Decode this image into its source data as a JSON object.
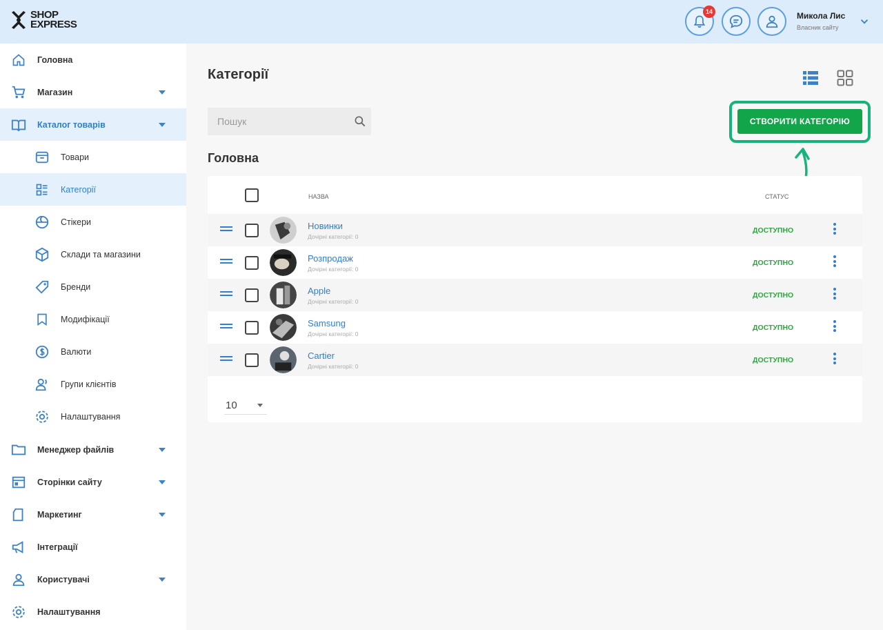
{
  "header": {
    "logo_line1": "SHOP",
    "logo_line2": "EXPRESS",
    "notification_count": "14",
    "user_name": "Микола Лис",
    "user_role": "Власник сайту",
    "accent_color": "#5a9fe0"
  },
  "sidebar": {
    "items": [
      {
        "label": "Головна",
        "icon": "home-icon"
      },
      {
        "label": "Магазин",
        "icon": "cart-icon",
        "has_submenu": true
      },
      {
        "label": "Каталог товарів",
        "icon": "catalog-icon",
        "has_submenu": true,
        "active": true
      },
      {
        "label": "Товари",
        "icon": "box-icon"
      },
      {
        "label": "Категорії",
        "icon": "categories-icon",
        "active": true
      },
      {
        "label": "Стікери",
        "icon": "sticker-icon"
      },
      {
        "label": "Склади та магазини",
        "icon": "warehouse-icon"
      },
      {
        "label": "Бренди",
        "icon": "tag-icon"
      },
      {
        "label": "Модифікації",
        "icon": "bookmark-icon"
      },
      {
        "label": "Валюти",
        "icon": "currency-icon"
      },
      {
        "label": "Групи клієнтів",
        "icon": "user-group-icon"
      },
      {
        "label": "Налаштування",
        "icon": "gear-icon"
      },
      {
        "label": "Менеджер файлів",
        "icon": "folder-icon",
        "has_submenu": true
      },
      {
        "label": "Сторінки сайту",
        "icon": "pages-icon",
        "has_submenu": true
      },
      {
        "label": "Маркетинг",
        "icon": "marketing-icon",
        "has_submenu": true
      },
      {
        "label": "Інтеграції",
        "icon": "megaphone-icon"
      },
      {
        "label": "Користувачі",
        "icon": "user-icon",
        "has_submenu": true
      },
      {
        "label": "Налаштування",
        "icon": "gear-icon"
      }
    ]
  },
  "main": {
    "title": "Категорії",
    "search_placeholder": "Пошук",
    "create_button": "СТВОРИТИ КАТЕГОРІЮ",
    "section_title": "Головна",
    "table": {
      "col_name": "Назва",
      "col_status": "Статус",
      "rows": [
        {
          "name": "Новинки",
          "sub": "Дочірні категорії: 0",
          "status": "ДОСТУПНО"
        },
        {
          "name": "Розпродаж",
          "sub": "Дочірні категорії: 0",
          "status": "ДОСТУПНО"
        },
        {
          "name": "Apple",
          "sub": "Дочірні категорії: 0",
          "status": "ДОСТУПНО"
        },
        {
          "name": "Samsung",
          "sub": "Дочірні категорії: 0",
          "status": "ДОСТУПНО"
        },
        {
          "name": "Cartier",
          "sub": "Дочірні категорії: 0",
          "status": "ДОСТУПНО"
        }
      ]
    },
    "page_size": "10",
    "status_color": "#2fa53f",
    "highlight_color": "#17b37a"
  }
}
